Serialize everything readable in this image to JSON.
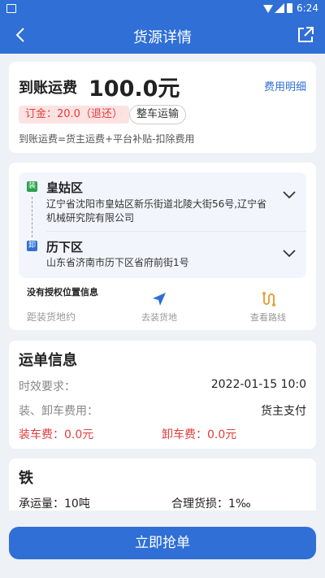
{
  "status_bar": {
    "time": "6:24"
  },
  "nav": {
    "title": "货源详情"
  },
  "fare": {
    "label": "到账运费",
    "amount": "100.0元",
    "detail_link": "费用明细",
    "deposit": "订金：20.0（退还）",
    "transport_type": "整车运输",
    "formula": "到账运费=货主运费+平台补贴-扣除费用"
  },
  "route": {
    "load_tag": "装",
    "load_district": "皇姑区",
    "load_address": "辽宁省沈阳市皇姑区新乐街道北陵大街56号,辽宁省机械研究院有限公司",
    "unload_tag": "卸",
    "unload_district": "历下区",
    "unload_address": "山东省济南市历下区省府前街1号",
    "no_auth": "没有授权位置信息",
    "distance_label": "距装货地约",
    "go_load": "去装货地",
    "view_route": "查看路线"
  },
  "waybill": {
    "heading": "运单信息",
    "time_label": "时效要求：",
    "time_value": "2022-01-15 10:0",
    "fee_label": "装、卸车费用：",
    "fee_value": "货主支付",
    "load_fee": "装车费：0.0元",
    "unload_fee": "卸车费：0.0元"
  },
  "cargo": {
    "name": "铁",
    "capacity": "承运量：10吨",
    "loss": "合理货损：1‰"
  },
  "action": {
    "grab": "立即抢单"
  },
  "colors": {
    "primary": "#2f6fd6",
    "danger": "#e23c3c",
    "load_tag": "#2ba24c",
    "route_icon": "#e8a23a"
  }
}
